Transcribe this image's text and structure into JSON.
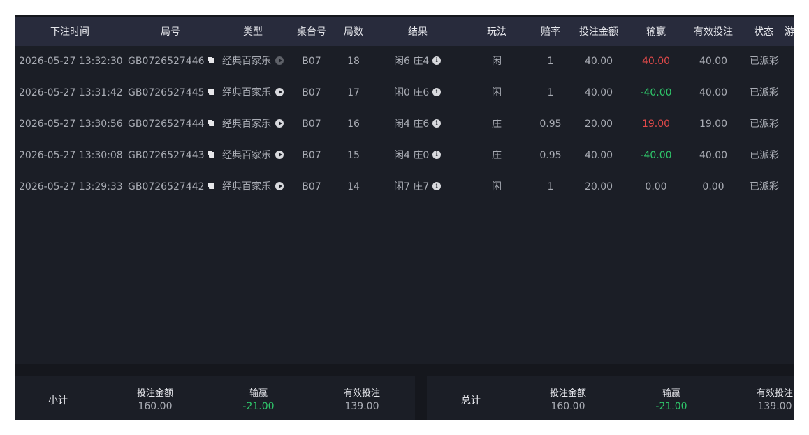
{
  "columns": [
    "下注时间",
    "局号",
    "类型",
    "桌台号",
    "局数",
    "结果",
    "玩法",
    "赔率",
    "投注金额",
    "输赢",
    "有效投注",
    "状态",
    "游"
  ],
  "rows": [
    {
      "time": "2026-05-27 13:32:30",
      "round_id": "GB0726527446",
      "type": "经典百家乐",
      "table": "B07",
      "round": "18",
      "result": "闲6 庄4",
      "bet_on": "闲",
      "odds": "1",
      "amount": "40.00",
      "win_loss": "40.00",
      "win_loss_state": "win",
      "valid_bet": "40.00",
      "status": "已派彩",
      "play_dim": true
    },
    {
      "time": "2026-05-27 13:31:42",
      "round_id": "GB0726527445",
      "type": "经典百家乐",
      "table": "B07",
      "round": "17",
      "result": "闲0 庄6",
      "bet_on": "闲",
      "odds": "1",
      "amount": "40.00",
      "win_loss": "-40.00",
      "win_loss_state": "lose",
      "valid_bet": "40.00",
      "status": "已派彩",
      "play_dim": false
    },
    {
      "time": "2026-05-27 13:30:56",
      "round_id": "GB0726527444",
      "type": "经典百家乐",
      "table": "B07",
      "round": "16",
      "result": "闲4 庄6",
      "bet_on": "庄",
      "odds": "0.95",
      "amount": "20.00",
      "win_loss": "19.00",
      "win_loss_state": "win",
      "valid_bet": "19.00",
      "status": "已派彩",
      "play_dim": false
    },
    {
      "time": "2026-05-27 13:30:08",
      "round_id": "GB0726527443",
      "type": "经典百家乐",
      "table": "B07",
      "round": "15",
      "result": "闲4 庄0",
      "bet_on": "庄",
      "odds": "0.95",
      "amount": "40.00",
      "win_loss": "-40.00",
      "win_loss_state": "lose",
      "valid_bet": "40.00",
      "status": "已派彩",
      "play_dim": false
    },
    {
      "time": "2026-05-27 13:29:33",
      "round_id": "GB0726527442",
      "type": "经典百家乐",
      "table": "B07",
      "round": "14",
      "result": "闲7 庄7",
      "bet_on": "闲",
      "odds": "1",
      "amount": "20.00",
      "win_loss": "0.00",
      "win_loss_state": "zero",
      "valid_bet": "0.00",
      "status": "已派彩",
      "play_dim": false
    }
  ],
  "subtotal": {
    "label": "小计",
    "amount_label": "投注金额",
    "amount": "160.00",
    "win_loss_label": "输赢",
    "win_loss": "-21.00",
    "valid_label": "有效投注",
    "valid": "139.00"
  },
  "total": {
    "label": "总计",
    "amount_label": "投注金额",
    "amount": "160.00",
    "win_loss_label": "输赢",
    "win_loss": "-21.00",
    "valid_label": "有效投注",
    "valid": "139.00"
  },
  "colors": {
    "win": "#e34a4a",
    "lose": "#2fc56a",
    "header_bg": "#282b3c",
    "panel_bg": "#1b1e26"
  },
  "icons": {
    "copy": "copy-icon",
    "play": "play-circle-icon",
    "info": "info-icon"
  }
}
